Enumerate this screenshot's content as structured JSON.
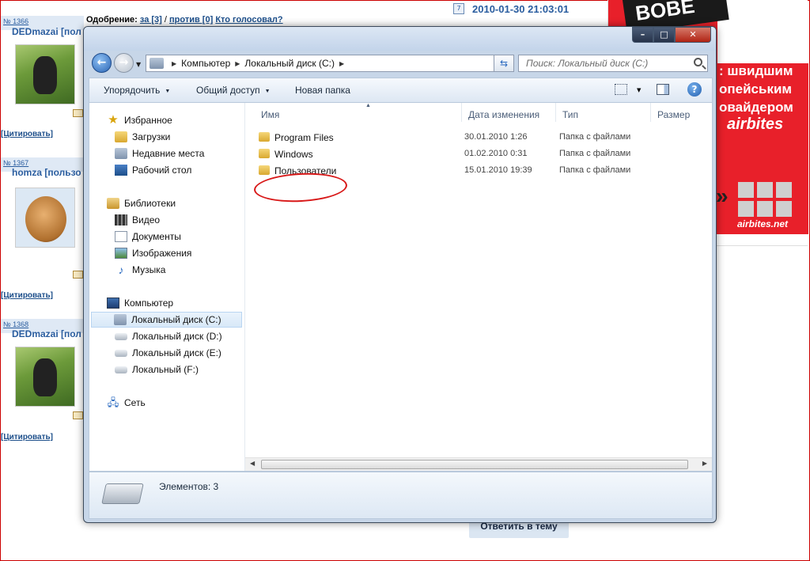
{
  "forum": {
    "approval_label": "Одобрение:",
    "vote_for": "за [3]",
    "vote_sep": "/",
    "vote_against": "против [0]",
    "who_voted": "Кто голосовал?",
    "post_date": "2010-01-30 21:03:01",
    "posts": [
      {
        "num": "№ 1366",
        "author": "DEDmazai [пол",
        "quote": "[Цитировать]"
      },
      {
        "num": "№ 1367",
        "author": "homza [пользо",
        "quote": "[Цитировать]"
      },
      {
        "num": "№ 1368",
        "author": "DEDmazai [пол",
        "quote": "[Цитировать]"
      }
    ],
    "reply_button": "Ответить в тему"
  },
  "ad": {
    "top_word": "BOBE",
    "line1": ": швидшим",
    "line2": "опейським",
    "line3": "овайдером",
    "brand": "airbites",
    "url": "airbites.net",
    "colors": {
      "red": "#e8202a",
      "black": "#1a1a1a"
    }
  },
  "explorer": {
    "window_buttons": {
      "minimize": "–",
      "maximize": "□",
      "close": "✕"
    },
    "address": {
      "segments": [
        "Компьютер",
        "Локальный диск (C:)"
      ]
    },
    "search_placeholder": "Поиск: Локальный диск (C:)",
    "toolbar": {
      "organize": "Упорядочить",
      "share": "Общий доступ",
      "new_folder": "Новая папка"
    },
    "nav": {
      "favorites": "Избранное",
      "downloads": "Загрузки",
      "recent": "Недавние места",
      "desktop": "Рабочий стол",
      "libraries": "Библиотеки",
      "video": "Видео",
      "documents": "Документы",
      "images": "Изображения",
      "music": "Музыка",
      "computer": "Компьютер",
      "drive_c": "Локальный диск (C:)",
      "drive_d": "Локальный диск (D:)",
      "drive_e": "Локальный диск (E:)",
      "drive_f": "Локальный (F:)",
      "network": "Сеть"
    },
    "columns": {
      "name": "Имя",
      "date": "Дата изменения",
      "type": "Тип",
      "size": "Размер"
    },
    "files": [
      {
        "name": "Program Files",
        "date": "30.01.2010 1:26",
        "type": "Папка с файлами"
      },
      {
        "name": "Windows",
        "date": "01.02.2010 0:31",
        "type": "Папка с файлами"
      },
      {
        "name": "Пользователи",
        "date": "15.01.2010 19:39",
        "type": "Папка с файлами"
      }
    ],
    "status": "Элементов: 3"
  }
}
